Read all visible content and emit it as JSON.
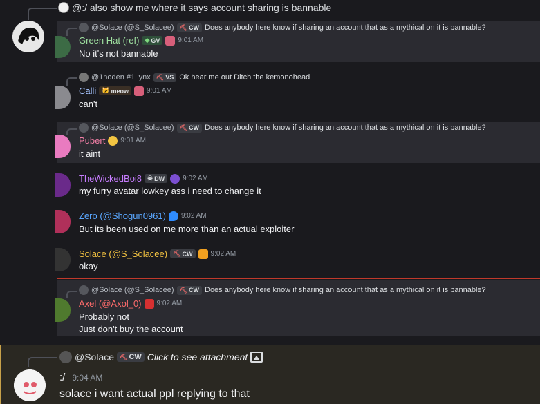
{
  "top_reply": {
    "preview": "@:/ also show me where it says account sharing is bannable"
  },
  "messages": [
    {
      "reply": {
        "author": "@Solace (@S_Solacee)",
        "tag": "CW",
        "text": "Does anybody here know if sharing an account that as a mythical on it is bannable?"
      },
      "author": "Green Hat (ref)",
      "author_color": "#9fe0a0",
      "badge": "GV",
      "time": "9:01 AM",
      "lines": [
        "No it's not bannable"
      ]
    },
    {
      "reply": {
        "author": "@1noden #1 lynx",
        "tag": "VS",
        "text": "Ok hear me out Ditch the kemonohead"
      },
      "author": "Calli",
      "author_color": "#a7c4ff",
      "badge": "meow",
      "time": "9:01 AM",
      "lines": [
        "can't"
      ]
    },
    {
      "reply": {
        "author": "@Solace (@S_Solacee)",
        "tag": "CW",
        "text": "Does anybody here know if sharing an account that as a mythical on it is bannable?"
      },
      "author": "Pubert",
      "author_color": "#f47fa7",
      "time": "9:01 AM",
      "lines": [
        "it aint"
      ]
    },
    {
      "author": "TheWickedBoi8",
      "author_color": "#c77dff",
      "badge": "DW",
      "time": "9:02 AM",
      "lines": [
        "my furry avatar lowkey ass i need to change it"
      ]
    },
    {
      "author": "Zero (@Shogun0961)",
      "author_color": "#5aa7ff",
      "time": "9:02 AM",
      "lines": [
        "But its been used on me more than an actual exploiter"
      ]
    },
    {
      "author": "Solace (@S_Solacee)",
      "author_color": "#f0c040",
      "badge": "CW",
      "time": "9:02 AM",
      "lines": [
        "okay"
      ]
    },
    {
      "reply": {
        "author": "@Solace (@S_Solacee)",
        "tag": "CW",
        "text": "Does anybody here know if sharing an account that as a mythical on it is bannable?"
      },
      "author": "Axel (@Axol_0)",
      "author_color": "#ff6b6b",
      "time": "9:02 AM",
      "lines": [
        "Probably not",
        "Just don't buy the account"
      ]
    },
    {
      "reply": {
        "author": "@Solace",
        "tag": "CW",
        "text": "Click to see attachment"
      },
      "author": ":/",
      "author_color": "#f2f3f5",
      "time": "9:04 AM",
      "lines": [
        "solace i want actual ppl replying to that"
      ]
    }
  ],
  "colors": {
    "background": "#1a1a1e",
    "highlight": "#2b2b31",
    "mention_bar": "#c7a14a",
    "new_divider": "#c0392b"
  },
  "icons": [
    "reply-spine",
    "image-icon",
    "pickaxe-icon"
  ]
}
